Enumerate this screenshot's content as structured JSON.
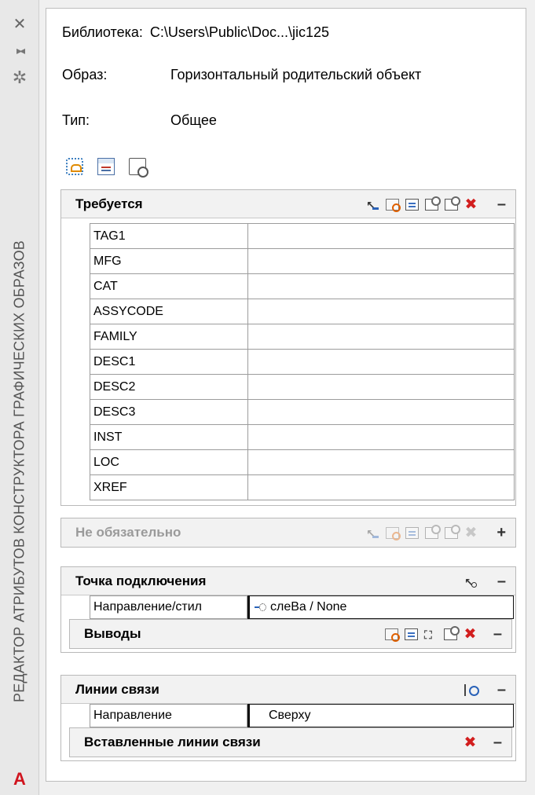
{
  "sidebar": {
    "title": "РЕДАКТОР АТРИБУТОВ КОНСТРУКТОРА ГРАФИЧЕСКИХ ОБРАЗОВ",
    "close_icon": "close-icon",
    "pin_icon": "pin-icon",
    "settings_icon": "gear-icon",
    "logo_letter": "A"
  },
  "info": {
    "library_label": "Библиотека:",
    "library_value": "C:\\Users\\Public\\Doc...\\jic125",
    "image_label": "Образ:",
    "image_value": "Горизонтальный родительский объект",
    "type_label": "Тип:",
    "type_value": "Общее"
  },
  "required": {
    "title": "Требуется",
    "toggle": "–",
    "attributes": [
      "TAG1",
      "MFG",
      "CAT",
      "ASSYCODE",
      "FAMILY",
      "DESC1",
      "DESC2",
      "DESC3",
      "INST",
      "LOC",
      "XREF"
    ]
  },
  "optional": {
    "title": "Не обязательно",
    "toggle": "+"
  },
  "connection": {
    "title": "Точка подключения",
    "toggle": "–",
    "prop_label": "Направление/стил",
    "prop_value": "слеВа / None",
    "pins": {
      "title": "Выводы",
      "toggle": "–"
    }
  },
  "wires": {
    "title": "Линии связи",
    "toggle": "–",
    "prop_label": "Направление",
    "prop_value": "Сверху",
    "inserted": {
      "title": "Вставленные линии связи",
      "toggle": "–"
    }
  },
  "colors": {
    "accent": "#2a62b8",
    "delete": "#d21e1e",
    "logo": "#d0141e"
  }
}
